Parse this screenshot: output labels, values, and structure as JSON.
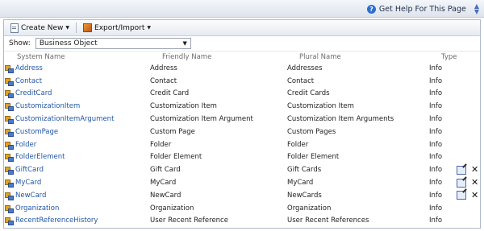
{
  "header": {
    "help_label": "Get Help For This Page"
  },
  "toolbar": {
    "create_new": "Create New",
    "export_import": "Export/Import"
  },
  "filter": {
    "show_label": "Show:",
    "selected": "Business Object"
  },
  "columns": {
    "system_name": "System Name",
    "friendly_name": "Friendly Name",
    "plural_name": "Plural Name",
    "type": "Type"
  },
  "rows": [
    {
      "system": "Address",
      "friendly": "Address",
      "plural": "Addresses",
      "type": "Info",
      "actions": false
    },
    {
      "system": "Contact",
      "friendly": "Contact",
      "plural": "Contact",
      "type": "Info",
      "actions": false
    },
    {
      "system": "CreditCard",
      "friendly": "Credit Card",
      "plural": "Credit Cards",
      "type": "Info",
      "actions": false
    },
    {
      "system": "CustomizationItem",
      "friendly": "Customization Item",
      "plural": "Customization Item",
      "type": "Info",
      "actions": false
    },
    {
      "system": "CustomizationItemArgument",
      "friendly": "Customization Item Argument",
      "plural": "Customization Item Arguments",
      "type": "Info",
      "actions": false
    },
    {
      "system": "CustomPage",
      "friendly": "Custom Page",
      "plural": "Custom Pages",
      "type": "Info",
      "actions": false
    },
    {
      "system": "Folder",
      "friendly": "Folder",
      "plural": "Folder",
      "type": "Info",
      "actions": false
    },
    {
      "system": "FolderElement",
      "friendly": "Folder Element",
      "plural": "Folder Element",
      "type": "Info",
      "actions": false
    },
    {
      "system": "GiftCard",
      "friendly": "Gift Card",
      "plural": "Gift Cards",
      "type": "Info",
      "actions": true
    },
    {
      "system": "MyCard",
      "friendly": "MyCard",
      "plural": "MyCard",
      "type": "Info",
      "actions": true
    },
    {
      "system": "NewCard",
      "friendly": "NewCard",
      "plural": "NewCards",
      "type": "Info",
      "actions": true
    },
    {
      "system": "Organization",
      "friendly": "Organization",
      "plural": "Organization",
      "type": "Info",
      "actions": false
    },
    {
      "system": "RecentReferenceHistory",
      "friendly": "User Recent Reference",
      "plural": "User Recent References",
      "type": "Info",
      "actions": false
    }
  ]
}
